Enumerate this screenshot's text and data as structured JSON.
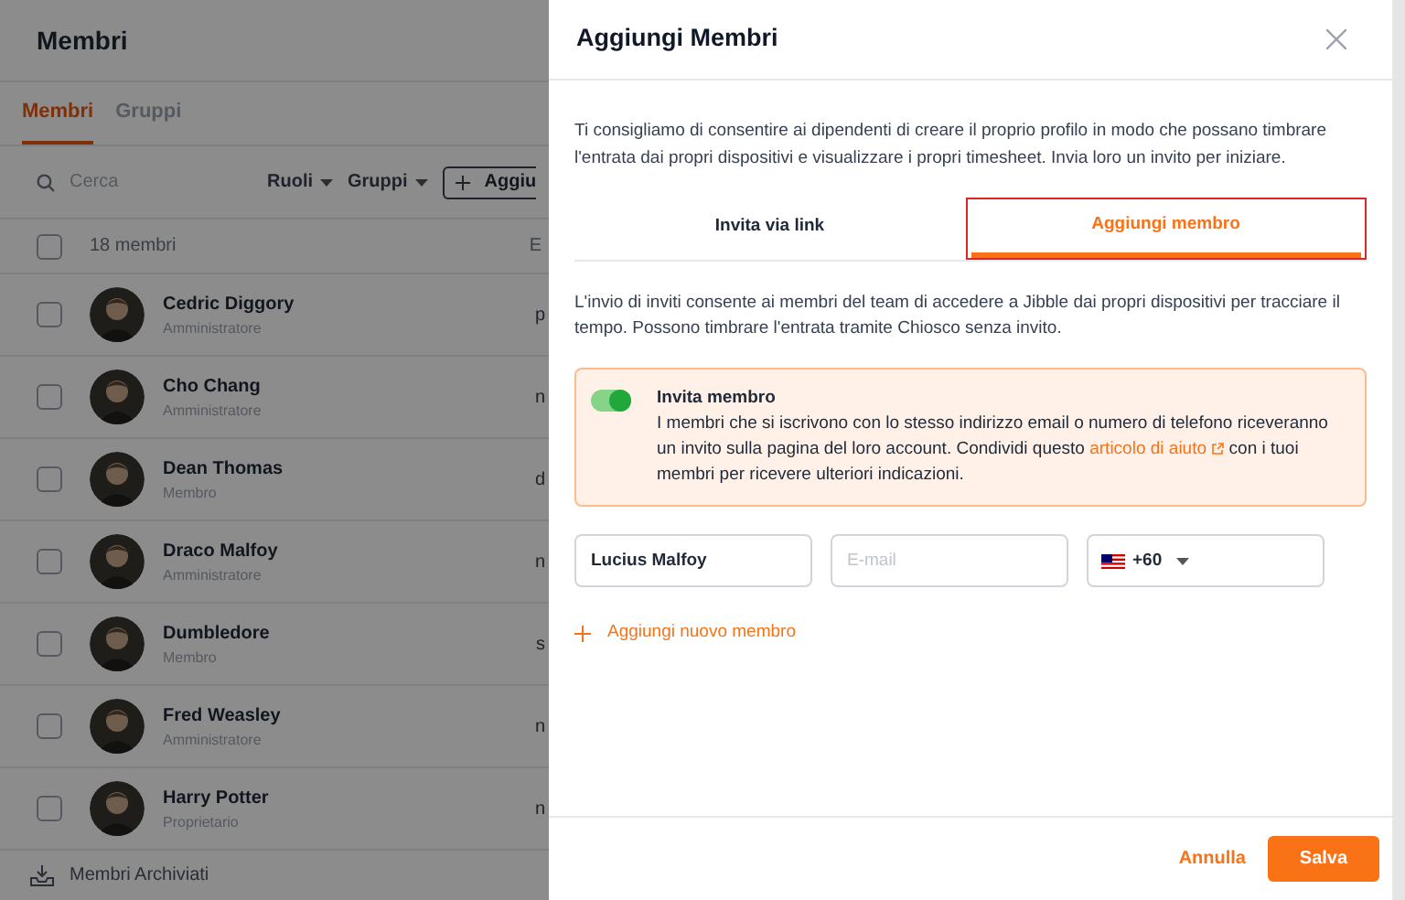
{
  "page": {
    "title": "Membri",
    "tabs": [
      {
        "label": "Membri",
        "selected": true
      },
      {
        "label": "Gruppi",
        "selected": false
      }
    ],
    "search": {
      "placeholder": "Cerca"
    },
    "filters": [
      "Ruoli",
      "Gruppi"
    ],
    "add_button": "Aggiu",
    "table": {
      "header": {
        "checked": false,
        "count": "18 membri",
        "column_3": "E"
      },
      "rows": [
        {
          "name": "Cedric Diggory",
          "role": "Amministratore",
          "column_3": "p",
          "checked": false
        },
        {
          "name": "Cho Chang",
          "role": "Amministratore",
          "column_3": "n",
          "checked": false
        },
        {
          "name": "Dean Thomas",
          "role": "Membro",
          "column_3": "d",
          "checked": false
        },
        {
          "name": "Draco Malfoy",
          "role": "Amministratore",
          "column_3": "n",
          "checked": false
        },
        {
          "name": "Dumbledore",
          "role": "Membro",
          "column_3": "s",
          "checked": false
        },
        {
          "name": "Fred Weasley",
          "role": "Amministratore",
          "column_3": "n",
          "checked": false
        },
        {
          "name": "Harry Potter",
          "role": "Proprietario",
          "column_3": "n",
          "checked": false
        }
      ]
    },
    "footer": "Membri Archiviati"
  },
  "dialog": {
    "title": "Aggiungi Membri",
    "intro": "Ti consigliamo di consentire ai dipendenti di creare il proprio profilo in modo che possano timbrare l'entrata dai propri dispositivi e visualizzare i propri timesheet. Invia loro un invito per iniziare.",
    "tabs": [
      {
        "label": "Invita via link",
        "selected": false,
        "highlighted": false
      },
      {
        "label": "Aggiungi membro",
        "selected": true,
        "highlighted": true
      }
    ],
    "description": "L'invio di inviti consente ai membri del team di accedere a Jibble dai propri dispositivi per tracciare il tempo. Possono timbrare l'entrata tramite Chiosco senza invito.",
    "invite": {
      "on": true,
      "title": "Invita membro",
      "text_before": "I membri che si iscrivono con lo stesso indirizzo email o numero di telefono riceveranno un invito sulla pagina del loro account. Condividi questo",
      "link": "articolo di aiuto",
      "text_after": "con i tuoi membri per ricevere ulteriori indicazioni."
    },
    "name_field": {
      "value": "Lucius Malfoy"
    },
    "email_field": {
      "placeholder": "E-mail"
    },
    "phone_field": {
      "code": "+60"
    },
    "add_link": "Aggiungi nuovo membro",
    "cancel": "Annulla",
    "save": "Salva"
  }
}
